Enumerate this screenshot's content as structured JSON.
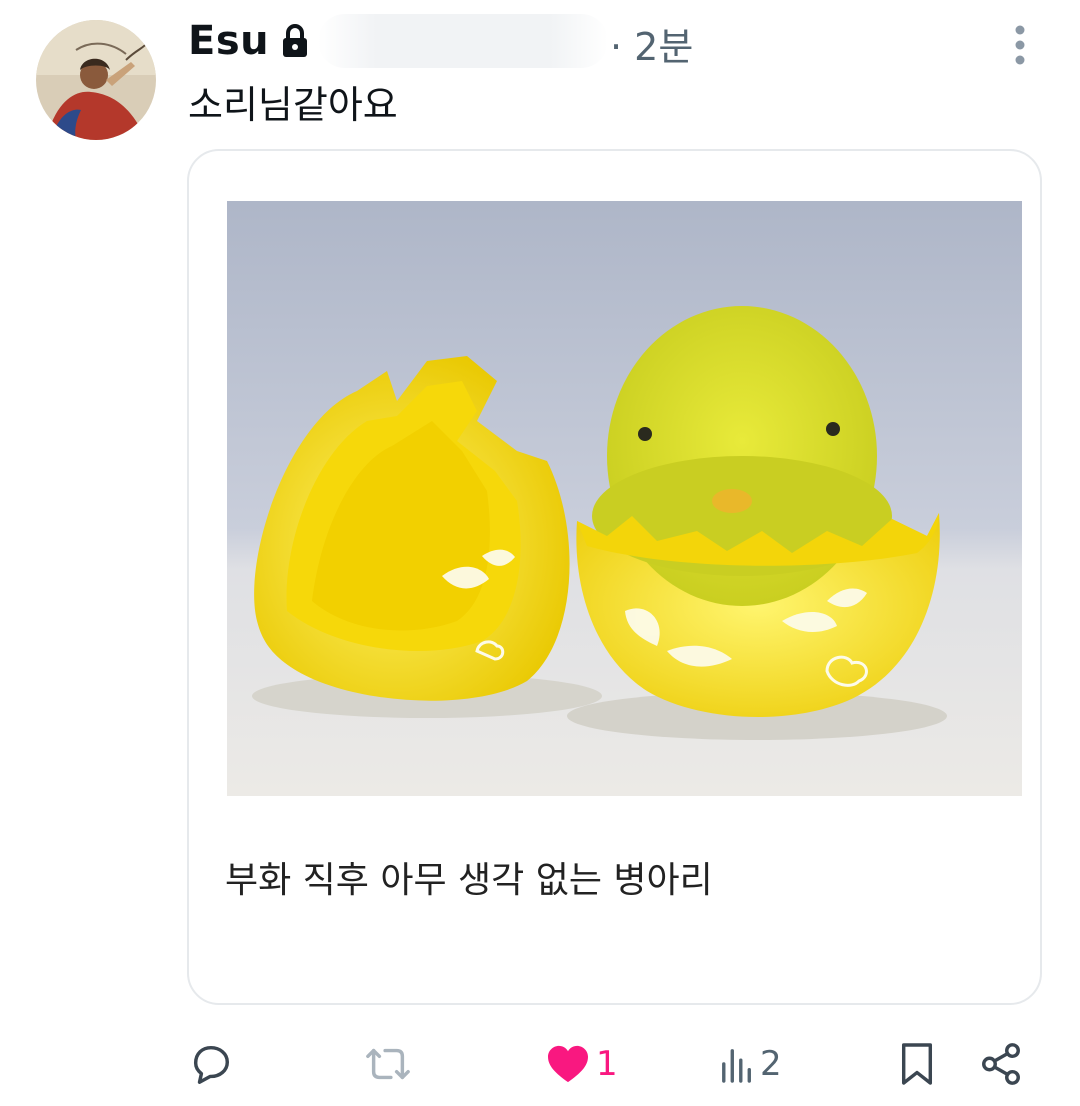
{
  "post": {
    "author_name": "Esu",
    "timestamp": "· 2분",
    "text": "소리님같아요"
  },
  "card": {
    "caption": "부화 직후 아무 생각 없는 병아리",
    "image_icon": "chick-in-eggshell-photo"
  },
  "icons": {
    "lock": "lock-icon",
    "more": "more-vertical-icon",
    "reply": "reply-icon",
    "repost": "repost-icon",
    "like": "heart-filled-icon",
    "views": "views-icon",
    "bookmark": "bookmark-icon",
    "share": "share-icon"
  },
  "actions": {
    "like_count": "1",
    "views_count": "2"
  },
  "colors": {
    "text_primary": "#0f1419",
    "text_secondary": "#536471",
    "like_pink": "#f91880",
    "border": "#e6e9ec"
  }
}
